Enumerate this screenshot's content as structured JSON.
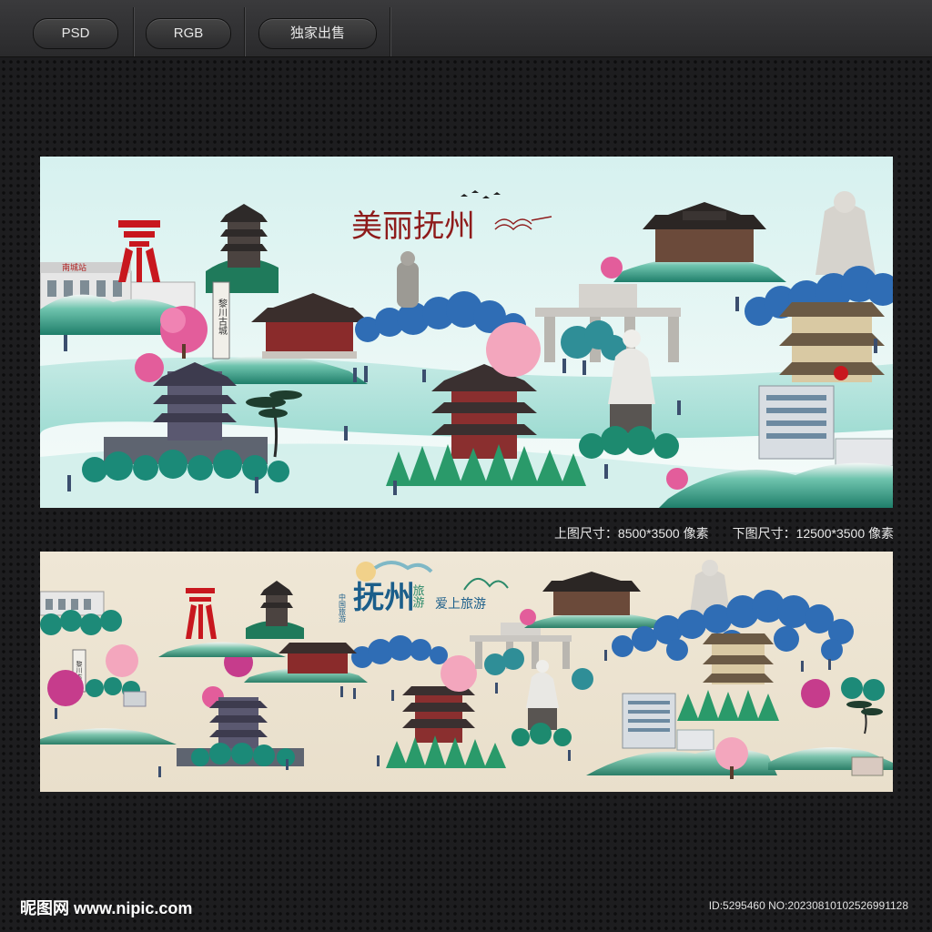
{
  "toolbar": {
    "tags": [
      "PSD",
      "RGB",
      "独家出售"
    ]
  },
  "poster_top": {
    "title": "美丽抚州",
    "station_sign": "南城站",
    "gate_plaque": "黎川古城"
  },
  "poster_bottom": {
    "title_main": "抚州",
    "title_side": "旅游",
    "subtitle": "爱上旅游",
    "badge": "中国旅游",
    "gate_plaque": "黎川古城"
  },
  "caption": {
    "top_size": "上图尺寸：8500*3500 像素",
    "bottom_size": "下图尺寸：12500*3500 像素"
  },
  "footer": {
    "logo": "昵图网 www.nipic.com",
    "id_text": "ID:5295460 NO:20230810102526991128"
  },
  "colors": {
    "background": "#1d1d1f",
    "top_sky": "#dff4f2",
    "bottom_paper": "#f1e9da",
    "teal_water": "#a8e0d8",
    "blue_trees": "#2f6db5",
    "green_trees": "#2e9a6b",
    "blossom": "#e86aa3",
    "red_sculpture": "#c8171e",
    "title_red": "#8e1b1b"
  }
}
